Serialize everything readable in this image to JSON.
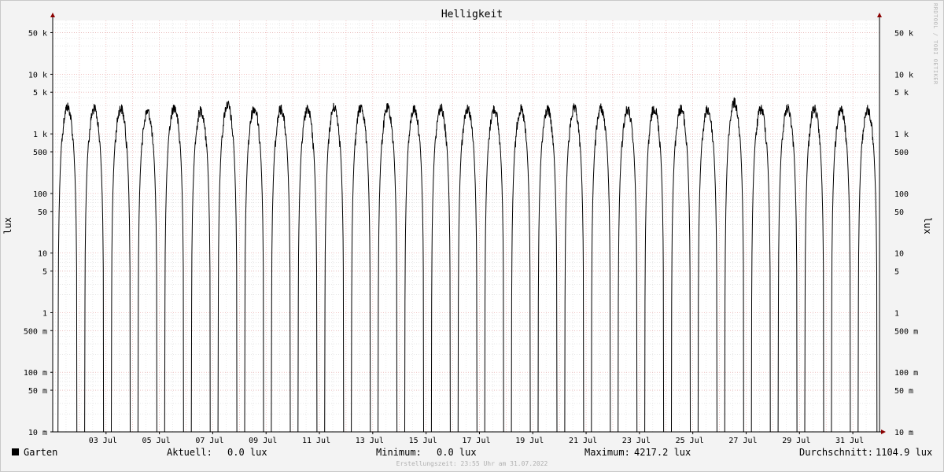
{
  "chart_data": {
    "type": "line",
    "title": "Helligkeit",
    "ylabel": "lux",
    "yscale": "log",
    "ylim": [
      0.01,
      80000
    ],
    "xlim": [
      "2022-07-01",
      "2022-08-01"
    ],
    "grid": true,
    "x_ticks": [
      "03 Jul",
      "05 Jul",
      "07 Jul",
      "09 Jul",
      "11 Jul",
      "13 Jul",
      "15 Jul",
      "17 Jul",
      "19 Jul",
      "21 Jul",
      "23 Jul",
      "25 Jul",
      "27 Jul",
      "29 Jul",
      "31 Jul"
    ],
    "y_ticks": [
      {
        "value": 50000,
        "label": "50 k"
      },
      {
        "value": 10000,
        "label": "10 k"
      },
      {
        "value": 5000,
        "label": "5 k"
      },
      {
        "value": 1000,
        "label": "1 k"
      },
      {
        "value": 500,
        "label": "500"
      },
      {
        "value": 100,
        "label": "100"
      },
      {
        "value": 50,
        "label": "50"
      },
      {
        "value": 10,
        "label": "10"
      },
      {
        "value": 5,
        "label": "5"
      },
      {
        "value": 1,
        "label": "1"
      },
      {
        "value": 0.5,
        "label": "500 m"
      },
      {
        "value": 0.1,
        "label": "100 m"
      },
      {
        "value": 0.05,
        "label": "50 m"
      },
      {
        "value": 0.01,
        "label": "10 m"
      }
    ],
    "series": [
      {
        "name": "Garten",
        "color": "#000000",
        "daily_peaks": [
          3500,
          3200,
          3300,
          2900,
          3400,
          3000,
          3800,
          3300,
          3200,
          3100,
          3400,
          3400,
          3300,
          3200,
          3300,
          3300,
          3200,
          3100,
          3100,
          3200,
          3300,
          3100,
          3300,
          3200,
          3100,
          4100,
          3200,
          3300,
          3200,
          3100
        ]
      }
    ],
    "stats": {
      "current_label": "Aktuell:",
      "current_value": "0.0 lux",
      "minimum_label": "Minimum:",
      "minimum_value": "0.0 lux",
      "maximum_label": "Maximum:",
      "maximum_value": "4217.2 lux",
      "average_label": "Durchschnitt:",
      "average_value": "1104.9 lux"
    }
  },
  "watermark": "RRDTOOL / TOBI OETIKER",
  "footer": "Erstellungszeit: 23:55 Uhr am 31.07.2022"
}
